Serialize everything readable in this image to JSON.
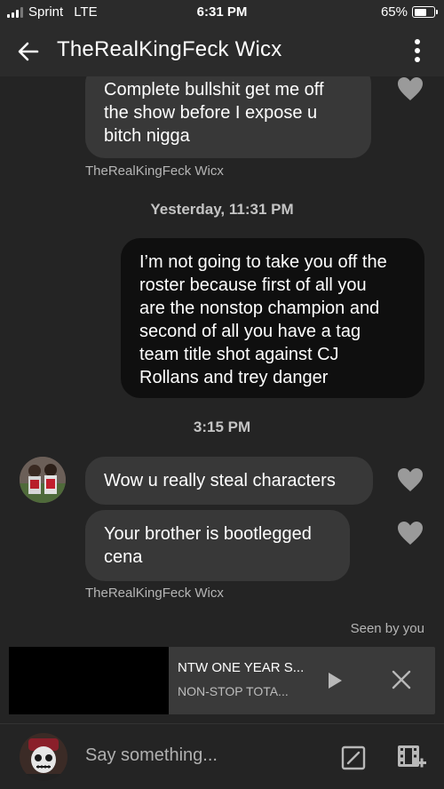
{
  "status_bar": {
    "carrier": "Sprint",
    "network": "LTE",
    "time": "6:31 PM",
    "battery_percent": "65%",
    "battery_level": 0.65
  },
  "header": {
    "title": "TheRealKingFeck Wicx",
    "back_icon": "arrow-left-icon",
    "menu_icon": "more-vertical-icon"
  },
  "messages": [
    {
      "direction": "incoming",
      "text_lines": [
        "Complete  bullshit  get me off",
        "the show before I expose  u",
        "bitch nigga"
      ]
    },
    {
      "direction": "outgoing",
      "text_lines": [
        "I’m not going to take you off the",
        "roster because first of all you",
        "are the nonstop champion and",
        "second of all you have a tag",
        "team title shot against CJ",
        "Rollans and trey danger"
      ]
    },
    {
      "direction": "incoming",
      "text_lines": [
        "Wow u really steal  characters"
      ]
    },
    {
      "direction": "incoming",
      "text_lines": [
        "Your brother  is bootlegged",
        "cena"
      ]
    }
  ],
  "sender_labels": [
    "TheRealKingFeck Wicx",
    "TheRealKingFeck Wicx"
  ],
  "timestamps": [
    "Yesterday, 11:31 PM",
    "3:15 PM"
  ],
  "seen_label": "Seen by you",
  "media": {
    "title": "NTW ONE YEAR S...",
    "subtitle": "NON-STOP TOTA..."
  },
  "composer": {
    "placeholder": "Say something..."
  },
  "colors": {
    "background": "#242424",
    "incoming_bubble": "#383838",
    "outgoing_bubble": "#0f0f0f"
  }
}
